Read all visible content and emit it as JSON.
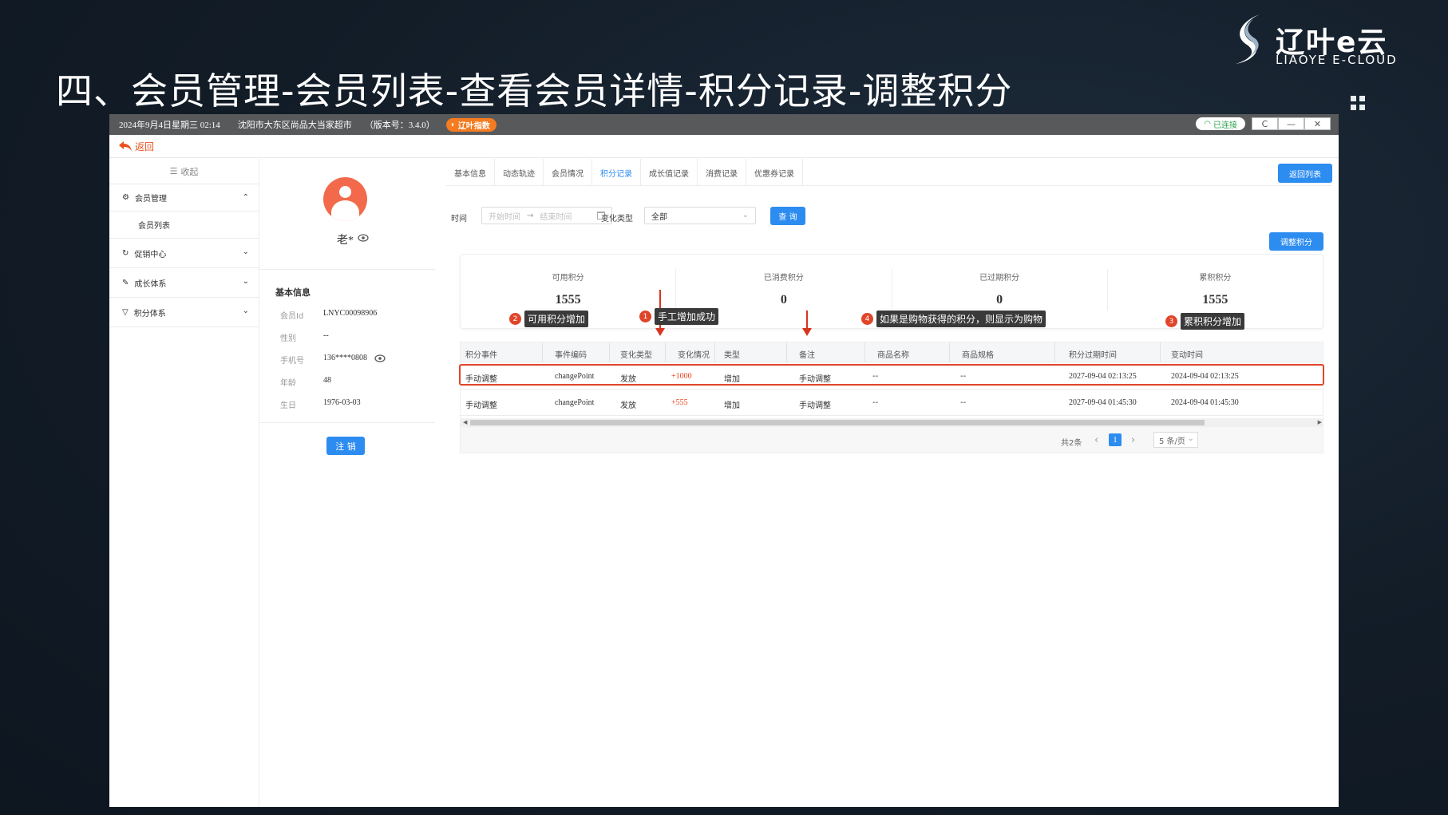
{
  "slide": {
    "title": "四、会员管理-会员列表-查看会员详情-积分记录-调整积分",
    "brand_cn": "辽叶e云",
    "brand_en": "LIAOYE E-CLOUD"
  },
  "titlebar": {
    "datetime": "2024年9月4日星期三 02:14",
    "store": "沈阳市大东区尚品大当家超市",
    "version": "（版本号：3.4.0）",
    "badge": "辽叶指数",
    "connection": "已连接",
    "refresh": "C",
    "minimize": "—",
    "close": "✕"
  },
  "back": {
    "label": "返回"
  },
  "sidebar": {
    "collapse": "收起",
    "items": [
      {
        "label": "会员管理",
        "icon": "gear-icon",
        "expanded": true,
        "chevron": "⌃"
      },
      {
        "label": "会员列表",
        "icon": ""
      },
      {
        "label": "促销中心",
        "icon": "refresh-icon",
        "chevron": "⌄"
      },
      {
        "label": "成长体系",
        "icon": "growth-icon",
        "chevron": "⌄"
      },
      {
        "label": "积分体系",
        "icon": "filter-icon",
        "chevron": "⌄"
      }
    ]
  },
  "profile": {
    "name": "老*",
    "info_title": "基本信息",
    "fields": [
      {
        "label": "会员Id",
        "value": "LNYC00098906"
      },
      {
        "label": "性别",
        "value": "--"
      },
      {
        "label": "手机号",
        "value": "136****0808"
      },
      {
        "label": "年龄",
        "value": "48"
      },
      {
        "label": "生日",
        "value": "1976-03-03"
      }
    ],
    "cancel_button": "注 销"
  },
  "tabs": [
    "基本信息",
    "动态轨迹",
    "会员情况",
    "积分记录",
    "成长值记录",
    "消费记录",
    "优惠券记录"
  ],
  "active_tab": "积分记录",
  "return_list_button": "返回列表",
  "filter": {
    "time_label": "时间",
    "start_placeholder": "开始时间",
    "range_sep": "→",
    "end_placeholder": "结束时间",
    "type_label": "变化类型",
    "type_value": "全部",
    "query_button": "查 询"
  },
  "adjust_button": "调整积分",
  "stats": [
    {
      "label": "可用积分",
      "value": "1555"
    },
    {
      "label": "已消费积分",
      "value": "0"
    },
    {
      "label": "已过期积分",
      "value": "0"
    },
    {
      "label": "累积积分",
      "value": "1555"
    }
  ],
  "callouts": [
    {
      "num": "1",
      "text": "手工增加成功"
    },
    {
      "num": "2",
      "text": "可用积分增加"
    },
    {
      "num": "3",
      "text": "累积积分增加"
    },
    {
      "num": "4",
      "text": "如果是购物获得的积分，则显示为购物"
    }
  ],
  "table": {
    "columns": [
      "积分事件",
      "事件编码",
      "变化类型",
      "变化情况",
      "类型",
      "备注",
      "商品名称",
      "商品规格",
      "积分过期时间",
      "变动时间"
    ],
    "rows": [
      [
        "手动调整",
        "changePoint",
        "发放",
        "+1000",
        "增加",
        "手动调整",
        "--",
        "--",
        "2027-09-04 02:13:25",
        "2024-09-04 02:13:25"
      ],
      [
        "手动调整",
        "changePoint",
        "发放",
        "+555",
        "增加",
        "手动调整",
        "--",
        "--",
        "2027-09-04 01:45:30",
        "2024-09-04 01:45:30"
      ]
    ]
  },
  "pager": {
    "total": "共2条",
    "prev": "‹",
    "page": "1",
    "next": "›",
    "size": "5 条/页"
  },
  "colors": {
    "accent": "#2d8cf0",
    "highlight": "#e0452a",
    "positive_change": "#e8431e",
    "background": "#121c27"
  }
}
